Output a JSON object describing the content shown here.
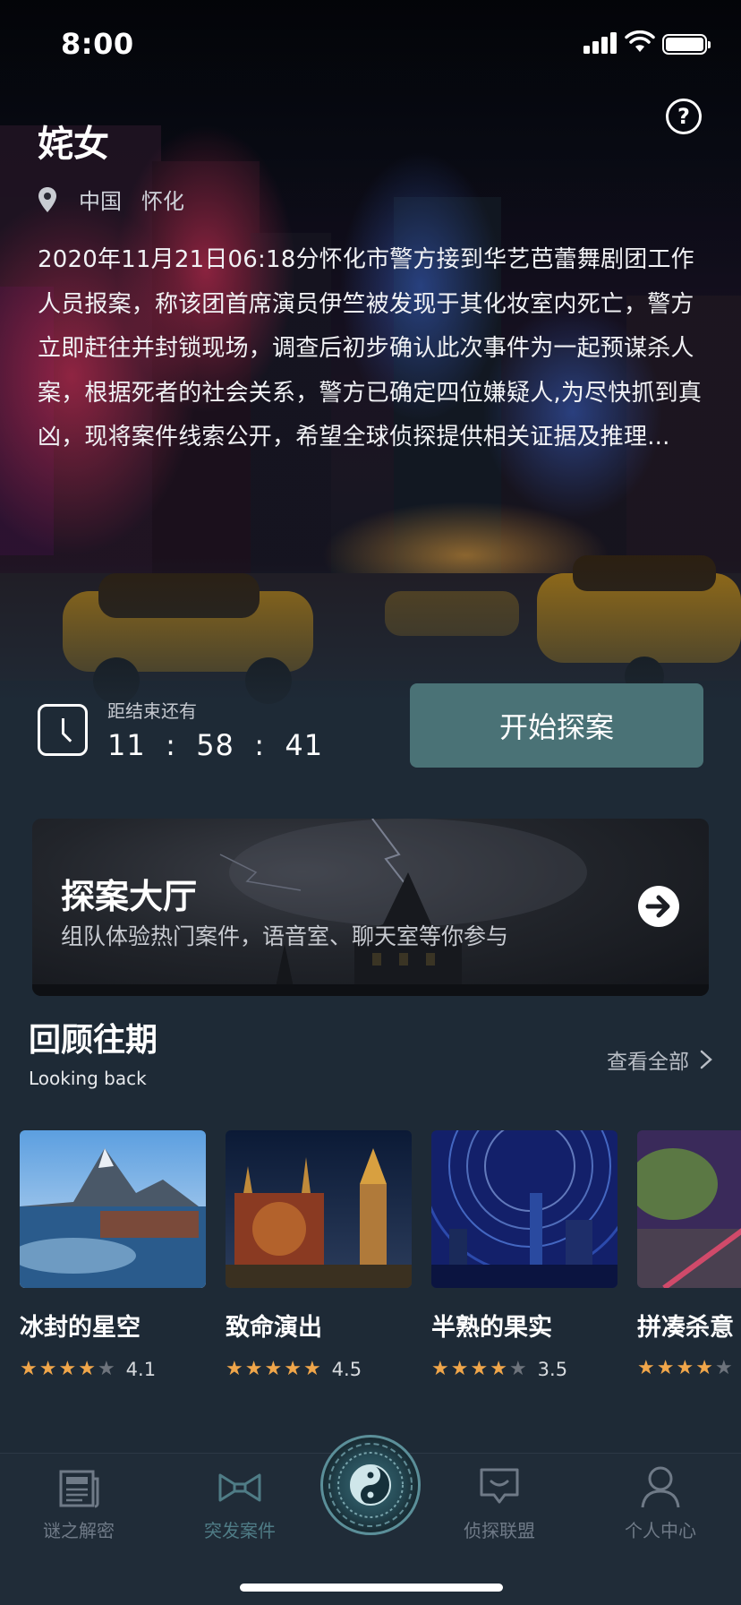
{
  "status_bar": {
    "time": "8:00"
  },
  "case": {
    "title": "姹女",
    "country": "中国",
    "city": "怀化",
    "description": "2020年11月21日06:18分怀化市警方接到华艺芭蕾舞剧团工作人员报案，称该团首席演员伊竺被发现于其化妆室内死亡，警方立即赶往并封锁现场，调查后初步确认此次事件为一起预谋杀人案，根据死者的社会关系，警方已确定四位嫌疑人,为尽快抓到真凶，现将案件线索公开，希望全球侦探提供相关证据及推理..."
  },
  "timer": {
    "label": "距结束还有",
    "value": "11  :  58  :  41"
  },
  "start_button": {
    "label": "开始探案"
  },
  "explore": {
    "title": "探案大厅",
    "subtitle": "组队体验热门案件，语音室、聊天室等你参与"
  },
  "looking_back": {
    "title": "回顾往期",
    "subtitle": "Looking back",
    "view_all": "查看全部",
    "cards": [
      {
        "title": "冰封的星空",
        "rating": 4.1,
        "score": "4.1",
        "stars": 4
      },
      {
        "title": "致命演出",
        "rating": 4.5,
        "score": "4.5",
        "stars": 5
      },
      {
        "title": "半熟的果实",
        "rating": 3.5,
        "score": "3.5",
        "stars": 4
      },
      {
        "title": "拼凑杀意",
        "rating": 4.0,
        "score": "",
        "stars": 4
      }
    ]
  },
  "tab_bar": {
    "tabs": [
      {
        "label": "谜之解密",
        "icon": "newspaper-icon"
      },
      {
        "label": "突发案件",
        "icon": "bow-icon"
      },
      {
        "label": "侦探联盟",
        "icon": "chat-bubble-icon"
      },
      {
        "label": "个人中心",
        "icon": "person-icon"
      }
    ],
    "center_icon": "taiji-icon"
  },
  "colors": {
    "background": "#1e2a36",
    "button": "#4a7276",
    "star": "#f0a64a",
    "active_tab": "#4f7c86",
    "inactive_tab": "#6f7a87"
  }
}
